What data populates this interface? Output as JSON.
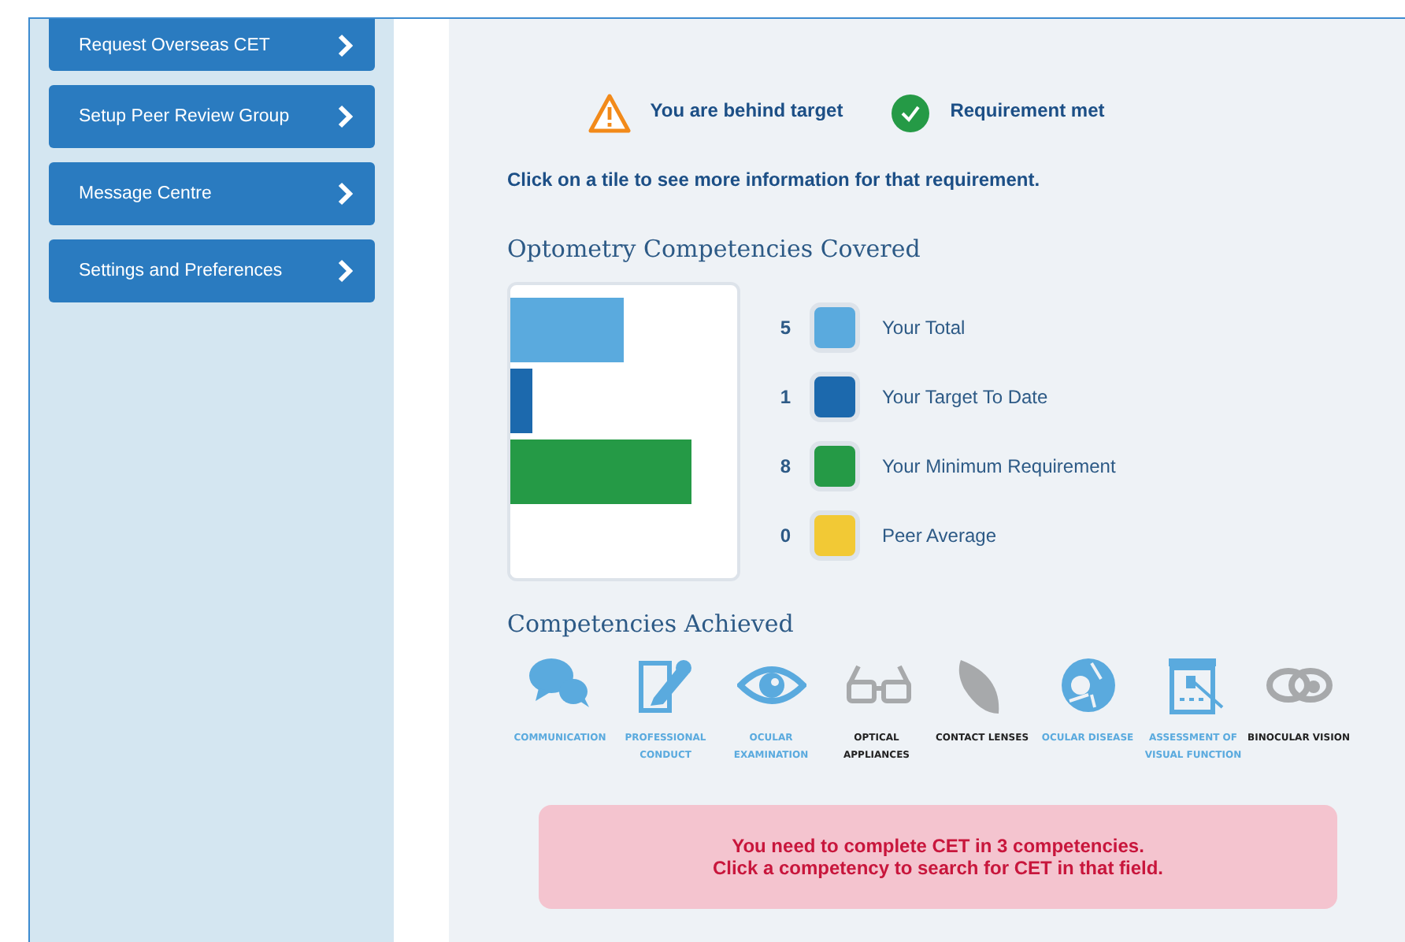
{
  "sidebar": {
    "items": [
      {
        "label": "Request Overseas CET"
      },
      {
        "label": "Setup Peer Review Group"
      },
      {
        "label": "Message Centre"
      },
      {
        "label": "Settings and Preferences"
      }
    ]
  },
  "status_key": [
    {
      "kind": "warning",
      "label": "You are behind target"
    },
    {
      "kind": "check",
      "label": "Requirement met"
    }
  ],
  "instruction": "Click on a tile to see more information for that requirement.",
  "covered": {
    "title": "Optometry Competencies Covered",
    "legend": [
      {
        "value": "5",
        "label": "Your Total",
        "color": "#5aaade",
        "level": 0.5
      },
      {
        "value": "1",
        "label": "Your Target To Date",
        "color": "#1c69ad",
        "level": 0.1
      },
      {
        "value": "8",
        "label": "Your Minimum Requirement",
        "color": "#259a46",
        "level": 0.8
      },
      {
        "value": "0",
        "label": "Peer Average",
        "color": "#f2c935",
        "level": 0
      }
    ]
  },
  "achieved": {
    "title": "Competencies Achieved",
    "items": [
      {
        "kind": "speech",
        "label": "COMMUNICATION",
        "highlighted": true
      },
      {
        "kind": "document",
        "label": "PROFESSIONAL CONDUCT",
        "highlighted": true
      },
      {
        "kind": "eye",
        "label": "OCULAR EXAMINATION",
        "highlighted": true
      },
      {
        "kind": "glasses",
        "label": "OPTICAL APPLIANCES",
        "highlighted": false
      },
      {
        "kind": "lens",
        "label": "CONTACT LENSES",
        "highlighted": false
      },
      {
        "kind": "eyeball",
        "label": "OCULAR DISEASE",
        "highlighted": true
      },
      {
        "kind": "chart",
        "label": "ASSESSMENT OF VISUAL FUNCTION",
        "highlighted": true
      },
      {
        "kind": "eyes",
        "label": "BINOCULAR VISION",
        "highlighted": false
      }
    ]
  },
  "alert": {
    "lines": [
      "You need to complete CET in 3 competencies.",
      "Click a competency to search for CET in that field."
    ]
  }
}
